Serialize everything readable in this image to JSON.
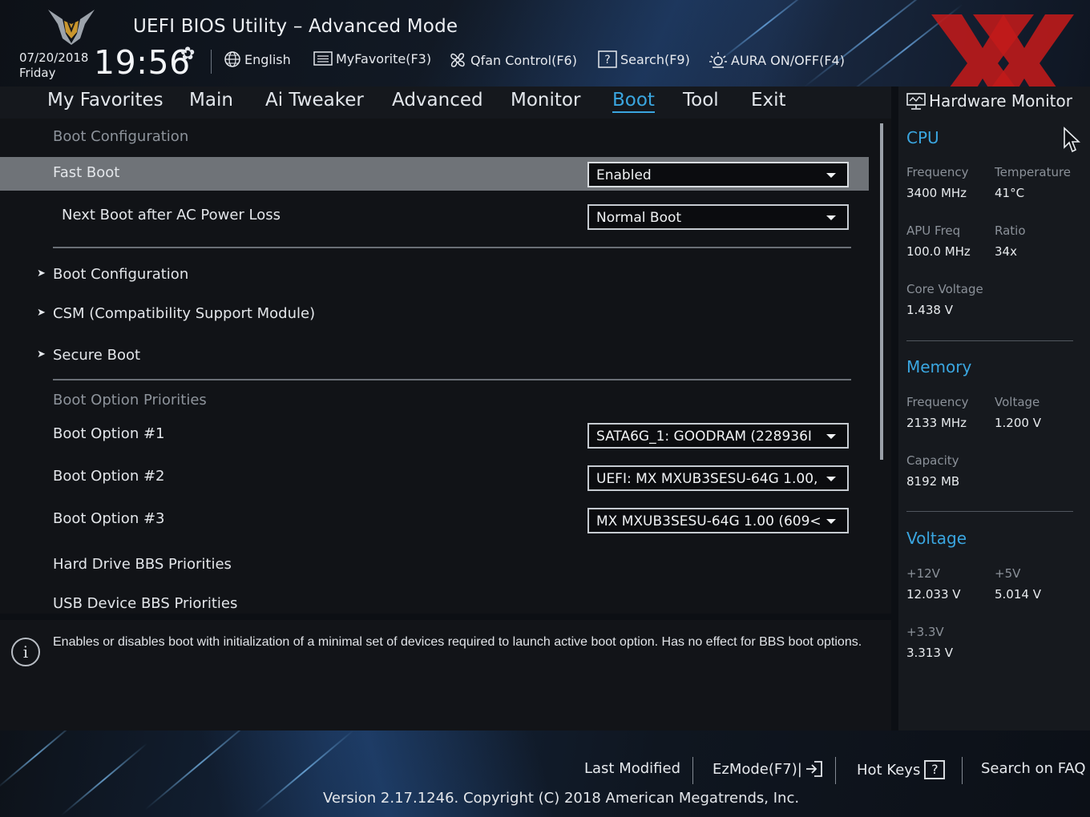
{
  "header": {
    "title": "UEFI BIOS Utility – Advanced Mode",
    "date": "07/20/2018",
    "day": "Friday",
    "time": "19:56",
    "tools": {
      "language": "English",
      "favorite": "MyFavorite(F3)",
      "qfan": "Qfan Control(F6)",
      "search": "Search(F9)",
      "aura": "AURA ON/OFF(F4)"
    }
  },
  "nav": {
    "tabs": [
      "My Favorites",
      "Main",
      "Ai Tweaker",
      "Advanced",
      "Monitor",
      "Boot",
      "Tool",
      "Exit"
    ],
    "active": "Boot"
  },
  "main": {
    "section1": "Boot Configuration",
    "fast_boot": {
      "label": "Fast Boot",
      "value": "Enabled"
    },
    "next_boot": {
      "label": "Next Boot after AC Power Loss",
      "value": "Normal Boot"
    },
    "submenus": [
      "Boot Configuration",
      "CSM (Compatibility Support Module)",
      "Secure Boot"
    ],
    "section2": "Boot Option Priorities",
    "boot_options": [
      {
        "label": "Boot Option #1",
        "value": "SATA6G_1: GOODRAM  (228936I"
      },
      {
        "label": "Boot Option #2",
        "value": "UEFI: MX MXUB3SESU-64G 1.00,"
      },
      {
        "label": "Boot Option #3",
        "value": "MX MXUB3SESU-64G 1.00  (609<"
      }
    ],
    "hdd_bbs": "Hard Drive BBS Priorities",
    "usb_bbs": "USB Device BBS Priorities"
  },
  "info": {
    "text": "Enables or disables boot with initialization of a minimal set of devices required to launch active boot option. Has no effect for BBS boot options."
  },
  "hw_monitor": {
    "title": "Hardware Monitor",
    "cpu": {
      "heading": "CPU",
      "frequency_label": "Frequency",
      "frequency": "3400 MHz",
      "temperature_label": "Temperature",
      "temperature": "41°C",
      "apu_label": "APU Freq",
      "apu": "100.0 MHz",
      "ratio_label": "Ratio",
      "ratio": "34x",
      "core_voltage_label": "Core Voltage",
      "core_voltage": "1.438 V"
    },
    "memory": {
      "heading": "Memory",
      "frequency_label": "Frequency",
      "frequency": "2133 MHz",
      "voltage_label": "Voltage",
      "voltage": "1.200 V",
      "capacity_label": "Capacity",
      "capacity": "8192 MB"
    },
    "voltage": {
      "heading": "Voltage",
      "v12_label": "+12V",
      "v12": "12.033 V",
      "v5_label": "+5V",
      "v5": "5.014 V",
      "v33_label": "+3.3V",
      "v33": "3.313 V"
    }
  },
  "footer": {
    "last_modified": "Last Modified",
    "ezmode": "EzMode(F7)|",
    "hotkeys": "Hot Keys",
    "faq": "Search on FAQ",
    "version": "Version 2.17.1246. Copyright (C) 2018 American Megatrends, Inc."
  },
  "colors": {
    "accent": "#3aa6e0",
    "selected_row": "#6f7378",
    "watermark": "#c21a1a"
  }
}
